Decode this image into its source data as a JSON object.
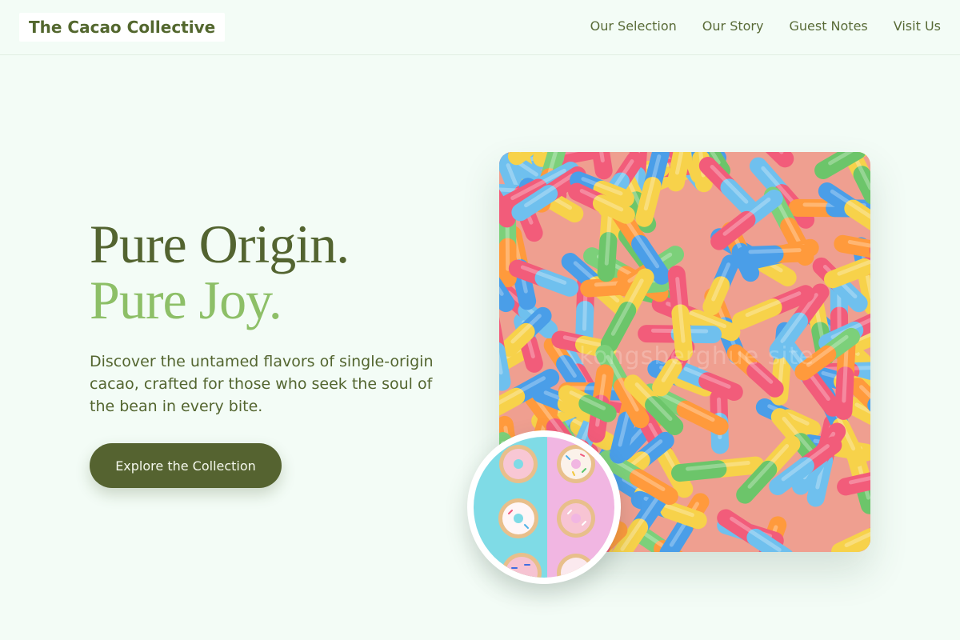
{
  "header": {
    "brand": "The Cacao Collective",
    "nav": [
      "Our Selection",
      "Our Story",
      "Guest Notes",
      "Visit Us"
    ]
  },
  "hero": {
    "title_line1": "Pure Origin.",
    "title_line2": "Pure Joy.",
    "description": "Discover the untamed flavors of single-origin cacao, crafted for those who seek the soul of the bean in every bite.",
    "cta_label": "Explore the Collection"
  },
  "images": {
    "main": "sour gummy worms photo",
    "main_watermark": "kongsberghue site",
    "secondary": "frosted donuts on teal and pink background"
  },
  "colors": {
    "background": "#f3fcf6",
    "brand_text": "#53672e",
    "title_primary": "#536430",
    "title_accent": "#8dbf67",
    "button": "#556330"
  }
}
